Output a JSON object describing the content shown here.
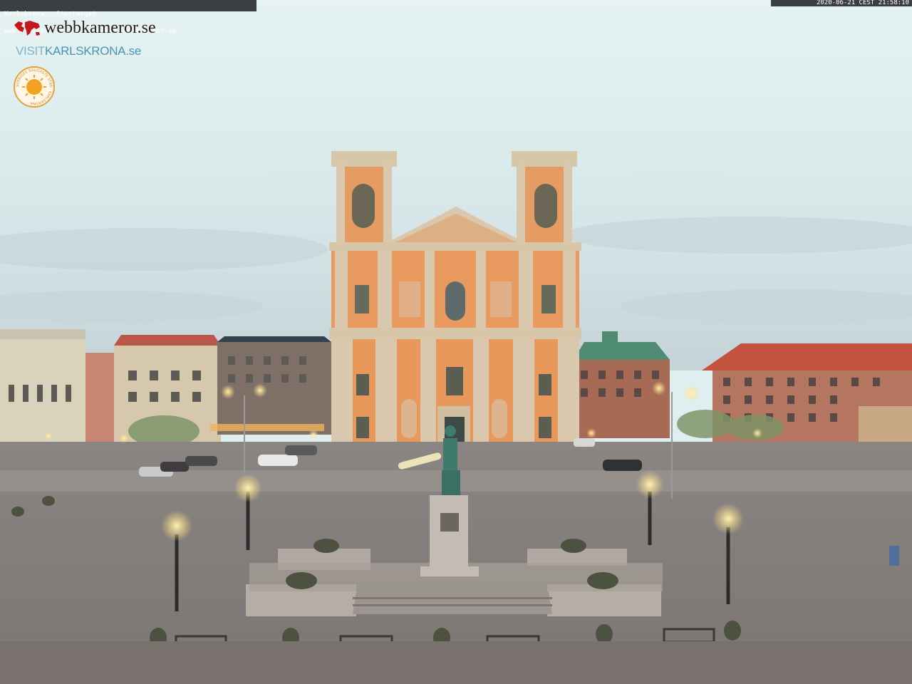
{
  "overlay": {
    "caption_line1": "Karlskrona - Stortorget",
    "caption_line2": "www.visitkarlskrona.se & www.webbkameror.se",
    "timestamp": "2020-06-21 CEST 21:58:10"
  },
  "logos": {
    "webbkameror": "webbkameror.se",
    "visit_prefix": "VISIT",
    "visit_main": "KARLSKRONA.se",
    "seal_text": "SVERIGES SOLIGASTE STAD · KARLSKRONA"
  },
  "colors": {
    "sky_top": "#e6f2f1",
    "sky_bottom": "#cfdde2",
    "church": "#e89a5f",
    "pilaster": "#ddc9ae",
    "square": "#8a8683",
    "lamp_light": "#ffd979"
  },
  "icons": {
    "world_map": "world-map-icon",
    "sun_seal": "sun-seal-icon"
  }
}
